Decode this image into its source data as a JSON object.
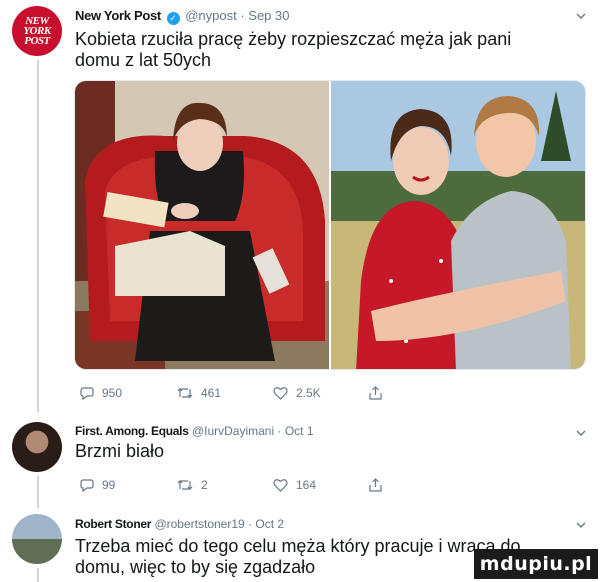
{
  "tweets": [
    {
      "name": "New York Post",
      "handle": "@nypost",
      "date": "Sep 30",
      "avatar_text": "NEW YORK POST",
      "text_line1": "Kobieta rzuciła pracę żeby rozpieszczać męża jak pani",
      "text_line2": "domu z lat 50ych",
      "replies": "950",
      "retweets": "461",
      "likes": "2.5K"
    },
    {
      "name": "First. Among. Equals",
      "handle": "@IurvDayimani",
      "date": "Oct 1",
      "text_line1": "Brzmi biało",
      "replies": "99",
      "retweets": "2",
      "likes": "164"
    },
    {
      "name": "Robert Stoner",
      "handle": "@robertstoner19",
      "date": "Oct 2",
      "text_line1": "Trzeba mieć do tego celu męża który pracuje i wraca do",
      "text_line2": "domu, więc to by się zgadzało"
    }
  ],
  "watermark": "mdupiu.pl",
  "colors": {
    "accent": "#1da1f2",
    "nypost_red": "#c8102e",
    "muted": "#657786"
  }
}
